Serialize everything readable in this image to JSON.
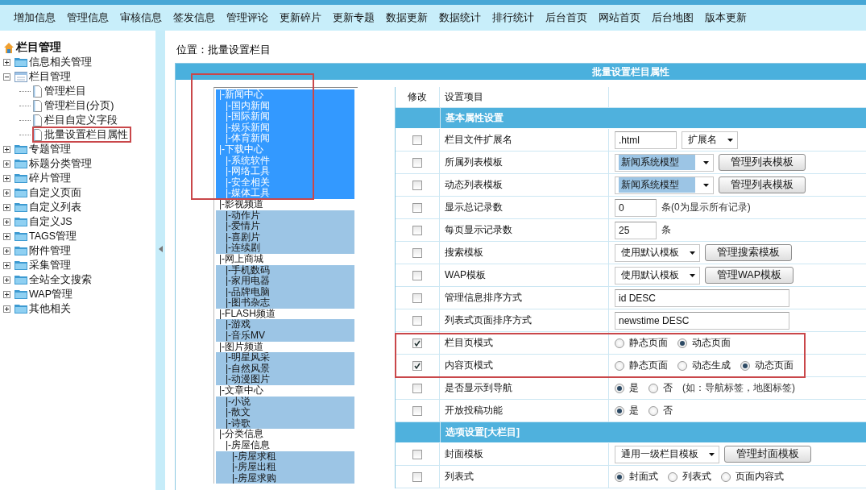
{
  "nav": [
    "增加信息",
    "管理信息",
    "审核信息",
    "签发信息",
    "管理评论",
    "更新碎片",
    "更新专题",
    "数据更新",
    "数据统计",
    "排行统计",
    "后台首页",
    "网站首页",
    "后台地图",
    "版本更新"
  ],
  "sidebar": {
    "title": "栏目管理",
    "items": [
      {
        "label": "信息相关管理",
        "expanded": false
      },
      {
        "label": "栏目管理",
        "expanded": true,
        "children": [
          {
            "label": "管理栏目"
          },
          {
            "label": "管理栏目(分页)"
          },
          {
            "label": "栏目自定义字段"
          },
          {
            "label": "批量设置栏目属性"
          }
        ]
      },
      {
        "label": "专题管理",
        "expanded": false
      },
      {
        "label": "标题分类管理",
        "expanded": false
      },
      {
        "label": "碎片管理",
        "expanded": false
      },
      {
        "label": "自定义页面",
        "expanded": false
      },
      {
        "label": "自定义列表",
        "expanded": false
      },
      {
        "label": "自定义JS",
        "expanded": false
      },
      {
        "label": "TAGS管理",
        "expanded": false
      },
      {
        "label": "附件管理",
        "expanded": false
      },
      {
        "label": "采集管理",
        "expanded": false
      },
      {
        "label": "全站全文搜索",
        "expanded": false
      },
      {
        "label": "WAP管理",
        "expanded": false
      },
      {
        "label": "其他相关",
        "expanded": false
      }
    ]
  },
  "location": "位置：批量设置栏目",
  "panel_title": "批量设置栏目属性",
  "column_list": [
    {
      "label": "|-新闻中心",
      "selected": true,
      "children": [
        {
          "label": "|-国内新闻",
          "selected": true
        },
        {
          "label": "|-国际新闻",
          "selected": true
        },
        {
          "label": "|-娱乐新闻",
          "selected": true
        },
        {
          "label": "|-体育新闻",
          "selected": true
        }
      ]
    },
    {
      "label": "|-下载中心",
      "selected": true,
      "children": [
        {
          "label": "|-系统软件",
          "selected": true
        },
        {
          "label": "|-网络工具",
          "selected": true
        },
        {
          "label": "|-安全相关",
          "selected": true
        },
        {
          "label": "|-媒体工具",
          "selected": true
        }
      ]
    },
    {
      "label": "|-影视频道",
      "selected": false,
      "children": [
        {
          "label": "|-动作片",
          "selected": false
        },
        {
          "label": "|-爱情片",
          "selected": false
        },
        {
          "label": "|-喜剧片",
          "selected": false
        },
        {
          "label": "|-连续剧",
          "selected": false
        }
      ]
    },
    {
      "label": "|-网上商城",
      "selected": false,
      "children": [
        {
          "label": "|-手机数码",
          "selected": false
        },
        {
          "label": "|-家用电器",
          "selected": false
        },
        {
          "label": "|-品牌电脑",
          "selected": false
        },
        {
          "label": "|-图书杂志",
          "selected": false
        }
      ]
    },
    {
      "label": "|-FLASH频道",
      "selected": false,
      "children": [
        {
          "label": "|-游戏",
          "selected": false
        },
        {
          "label": "|-音乐MV",
          "selected": false
        }
      ]
    },
    {
      "label": "|-图片频道",
      "selected": false,
      "children": [
        {
          "label": "|-明星风采",
          "selected": false
        },
        {
          "label": "|-自然风景",
          "selected": false
        },
        {
          "label": "|-动漫图片",
          "selected": false
        }
      ]
    },
    {
      "label": "|-文章中心",
      "selected": false,
      "children": [
        {
          "label": "|-小说",
          "selected": false
        },
        {
          "label": "|-散文",
          "selected": false
        },
        {
          "label": "|-诗歌",
          "selected": false
        }
      ]
    },
    {
      "label": "|-分类信息",
      "selected": false,
      "children": [
        {
          "label": "|-房屋信息",
          "selected": false,
          "children": [
            {
              "label": "|-房屋求租",
              "selected": false
            },
            {
              "label": "|-房屋出租",
              "selected": false
            },
            {
              "label": "|-房屋求购",
              "selected": false
            }
          ]
        }
      ]
    }
  ],
  "settings": {
    "columns": [
      "修改",
      "设置项目"
    ],
    "rows": [
      {
        "kind": "section",
        "title": "基本属性设置"
      },
      {
        "kind": "input_select",
        "label": "栏目文件扩展名",
        "checked": false,
        "value": ".html",
        "select": "扩展名"
      },
      {
        "kind": "select_button",
        "label": "所属列表模板",
        "checked": false,
        "select": "新闻系统模型",
        "highlighted": true,
        "button": "管理列表模板"
      },
      {
        "kind": "select_button",
        "label": "动态列表模板",
        "checked": false,
        "select": "新闻系统模型",
        "highlighted": true,
        "button": "管理列表模板"
      },
      {
        "kind": "number_input",
        "label": "显示总记录数",
        "checked": false,
        "value": "0",
        "note": "条(0为显示所有记录)"
      },
      {
        "kind": "number_input",
        "label": "每页显示记录数",
        "checked": false,
        "value": "25",
        "note": "条"
      },
      {
        "kind": "select_button",
        "label": "搜索模板",
        "checked": false,
        "select": "使用默认模板",
        "highlighted": false,
        "button": "管理搜索模板"
      },
      {
        "kind": "select_button",
        "label": "WAP模板",
        "checked": false,
        "select": "使用默认模板",
        "highlighted": false,
        "button": "管理WAP模板"
      },
      {
        "kind": "text_input",
        "label": "管理信息排序方式",
        "checked": false,
        "value": "id DESC"
      },
      {
        "kind": "text_input",
        "label": "列表式页面排序方式",
        "checked": false,
        "value": "newstime DESC"
      },
      {
        "kind": "radios",
        "label": "栏目页模式",
        "checked": true,
        "options": [
          {
            "label": "静态页面",
            "selected": false
          },
          {
            "label": "动态页面",
            "selected": true
          }
        ]
      },
      {
        "kind": "radios",
        "label": "内容页模式",
        "checked": true,
        "options": [
          {
            "label": "静态页面",
            "selected": false
          },
          {
            "label": "动态生成",
            "selected": false
          },
          {
            "label": "动态页面",
            "selected": true
          }
        ]
      },
      {
        "kind": "radios",
        "label": "是否显示到导航",
        "checked": false,
        "options": [
          {
            "label": "是",
            "selected": true
          },
          {
            "label": "否",
            "selected": false
          }
        ],
        "note": "(如：导航标签，地图标签)"
      },
      {
        "kind": "radios",
        "label": "开放投稿功能",
        "checked": false,
        "options": [
          {
            "label": "是",
            "selected": true
          },
          {
            "label": "否",
            "selected": false
          }
        ]
      },
      {
        "kind": "section",
        "title": "选项设置[大栏目]"
      },
      {
        "kind": "select_button",
        "label": "封面模板",
        "checked": false,
        "select": "通用一级栏目模板",
        "highlighted": false,
        "button": "管理封面模板"
      },
      {
        "kind": "radios",
        "label": "列表式",
        "checked": false,
        "options": [
          {
            "label": "封面式",
            "selected": true
          },
          {
            "label": "列表式",
            "selected": false
          },
          {
            "label": "页面内容式",
            "selected": false
          }
        ]
      }
    ]
  }
}
